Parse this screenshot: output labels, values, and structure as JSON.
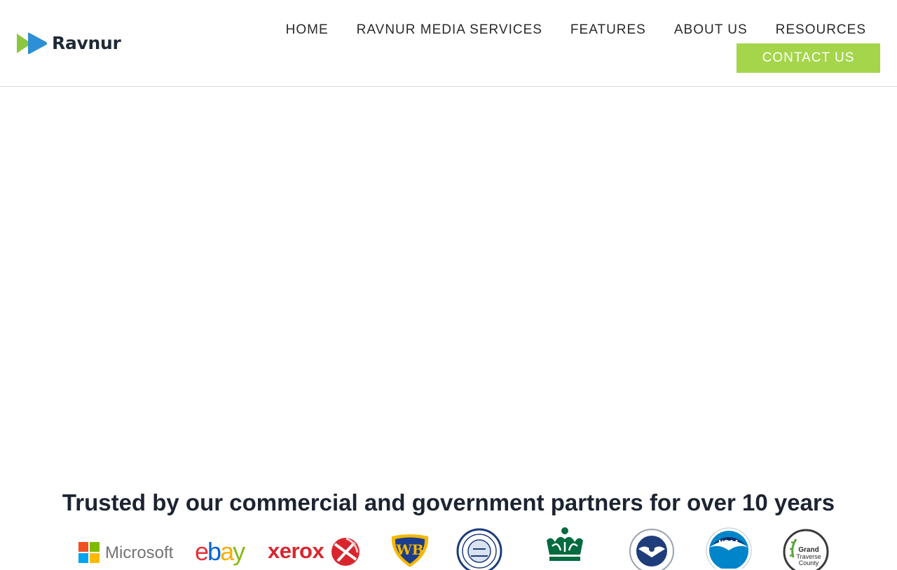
{
  "brand": {
    "name": "Ravnur"
  },
  "nav": {
    "items": [
      {
        "label": "HOME"
      },
      {
        "label": "RAVNUR MEDIA SERVICES"
      },
      {
        "label": "FEATURES"
      },
      {
        "label": "ABOUT US"
      },
      {
        "label": "RESOURCES"
      }
    ],
    "contact_label": "CONTACT US"
  },
  "partners": {
    "heading": "Trusted by our commercial and government partners for over 10 years",
    "logos": [
      {
        "name": "Microsoft",
        "icon": "microsoft-logo"
      },
      {
        "name": "ebay",
        "icon": "ebay-logo"
      },
      {
        "name": "xerox",
        "icon": "xerox-logo"
      },
      {
        "name": "WB",
        "icon": "warner-bros-logo"
      },
      {
        "name": "",
        "icon": "county-seal-logo"
      },
      {
        "name": "",
        "icon": "crown-logo"
      },
      {
        "name": "",
        "icon": "dhs-seal-logo"
      },
      {
        "name": "NOAA",
        "icon": "noaa-logo"
      },
      {
        "name": "Grand Traverse County",
        "icon": "grand-traverse-county-logo"
      }
    ]
  },
  "colors": {
    "accent": "#a4d54a",
    "logo_green": "#8cc63f",
    "logo_blue": "#2d8fd6",
    "text": "#1c2331"
  }
}
